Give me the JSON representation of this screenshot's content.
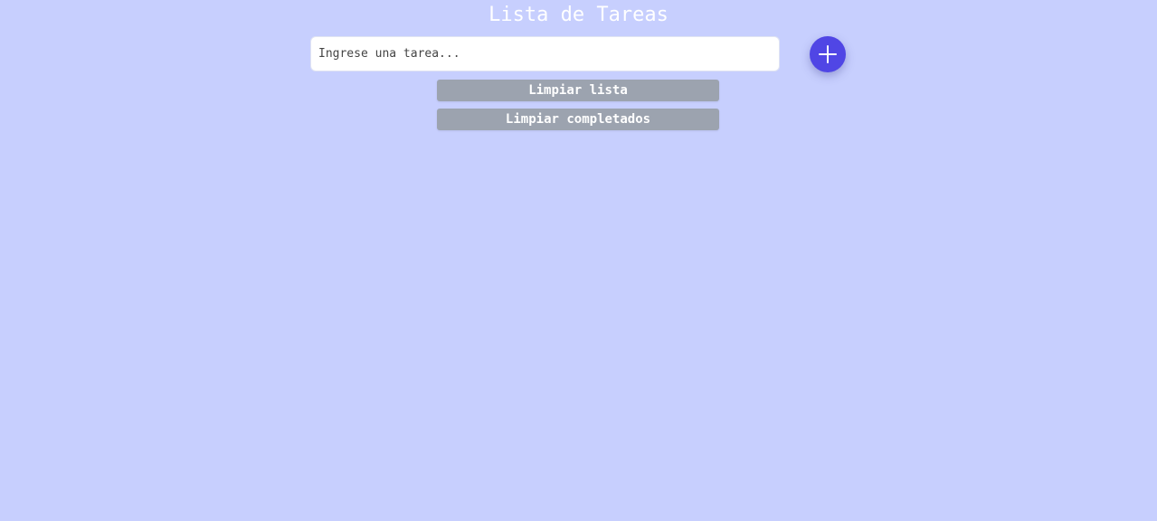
{
  "header": {
    "title": "Lista de Tareas"
  },
  "form": {
    "input_placeholder": "Ingrese una tarea...",
    "input_value": "",
    "add_button_icon": "plus-icon"
  },
  "actions": {
    "clear_list_label": "Limpiar lista",
    "clear_completed_label": "Limpiar completados"
  },
  "tasks": [],
  "colors": {
    "background": "#c7cffe",
    "accent": "#5046e5",
    "button_gray": "#9ca3af"
  }
}
